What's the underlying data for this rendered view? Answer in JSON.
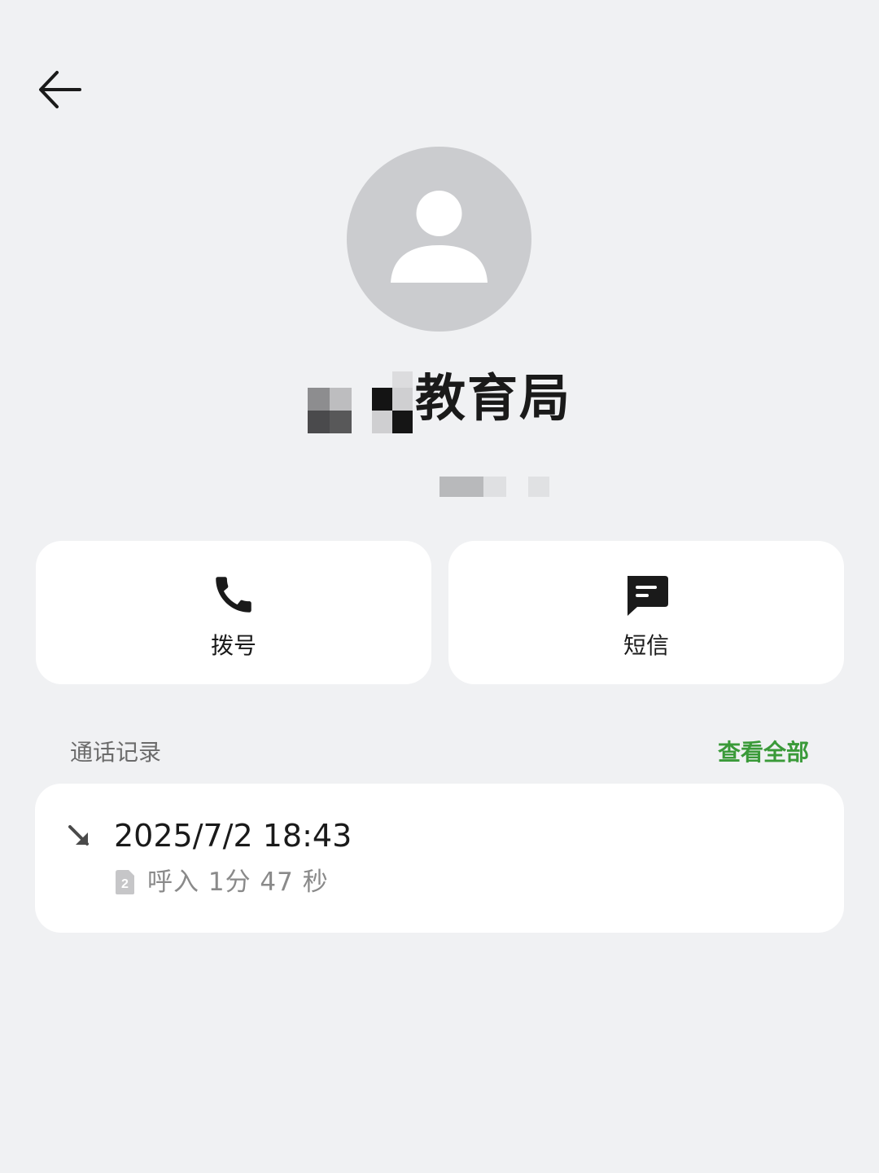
{
  "contact": {
    "name_visible": "教育局"
  },
  "actions": {
    "call_label": "拨号",
    "sms_label": "短信"
  },
  "call_log": {
    "section_title": "通话记录",
    "view_all_label": "查看全部",
    "records": [
      {
        "datetime": "2025/7/2 18:43",
        "sim": "2",
        "detail": "呼入 1分 47 秒"
      }
    ]
  },
  "colors": {
    "background": "#f0f1f3",
    "card": "#ffffff",
    "accent_green": "#3a9a39",
    "avatar_bg": "#cbcccf"
  },
  "icons": {
    "back": "arrow-left-icon",
    "avatar": "person-icon",
    "call": "phone-icon",
    "sms": "message-icon",
    "incoming": "incoming-call-arrow-icon",
    "sim": "sim-card-icon"
  }
}
